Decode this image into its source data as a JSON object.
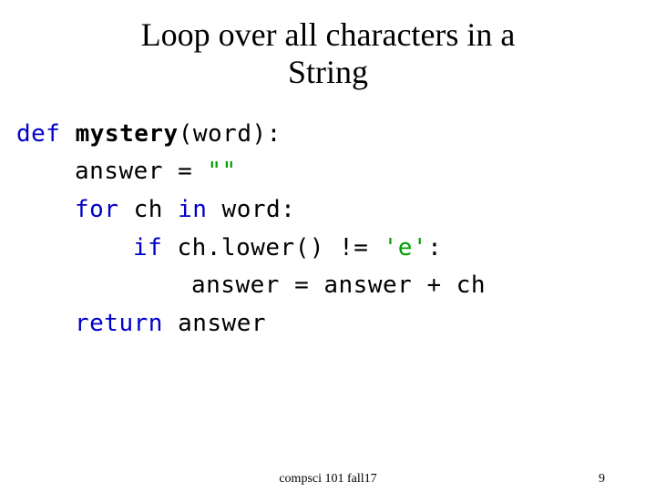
{
  "title_line1": "Loop over all characters in a",
  "title_line2": "String",
  "code": {
    "l1_def": "def",
    "l1_fn": "mystery",
    "l1_rest": "(word):",
    "l2_lhs": "answer = ",
    "l2_str": "\"\"",
    "l3_for": "for",
    "l3_mid": " ch ",
    "l3_in": "in",
    "l3_rest": " word:",
    "l4_if": "if",
    "l4_mid": " ch.lower() != ",
    "l4_str": "'e'",
    "l4_colon": ":",
    "l5": "answer = answer + ch",
    "l6_return": "return",
    "l6_rest": " answer"
  },
  "footer_center": "compsci 101 fall17",
  "footer_right": "9"
}
